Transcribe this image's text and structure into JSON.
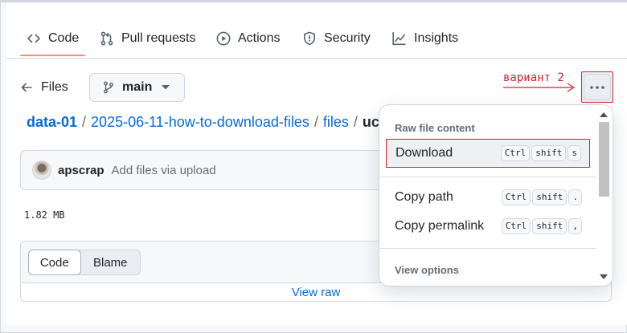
{
  "tabs": [
    {
      "label": "Code",
      "icon": "code-icon",
      "active": true
    },
    {
      "label": "Pull requests",
      "icon": "git-pull-request-icon"
    },
    {
      "label": "Actions",
      "icon": "play-icon"
    },
    {
      "label": "Security",
      "icon": "shield-icon"
    },
    {
      "label": "Insights",
      "icon": "graph-icon"
    }
  ],
  "toolbar": {
    "files_label": "Files",
    "branch_label": "main"
  },
  "breadcrumb": {
    "root": "data-01",
    "sep": "/",
    "segments": [
      "2025-06-11-how-to-download-files",
      "files"
    ],
    "current": "uc"
  },
  "commit": {
    "user": "apscrap",
    "message": "Add files via upload"
  },
  "file_size": "1.82 MB",
  "viewer": {
    "code_label": "Code",
    "blame_label": "Blame",
    "view_raw": "View raw"
  },
  "annotation": {
    "text": "вариант 2",
    "color": "#cf222e"
  },
  "menu": {
    "group1_label": "Raw file content",
    "download": {
      "label": "Download",
      "keys": [
        "Ctrl",
        "shift",
        "s"
      ]
    },
    "copy_path": {
      "label": "Copy path",
      "keys": [
        "Ctrl",
        "shift",
        "."
      ]
    },
    "copy_permalink": {
      "label": "Copy permalink",
      "keys": [
        "Ctrl",
        "shift",
        ","
      ]
    },
    "group2_label": "View options"
  },
  "colors": {
    "accent_underline": "#fd8c73",
    "link": "#0969da",
    "highlight_border": "#cf222e"
  }
}
